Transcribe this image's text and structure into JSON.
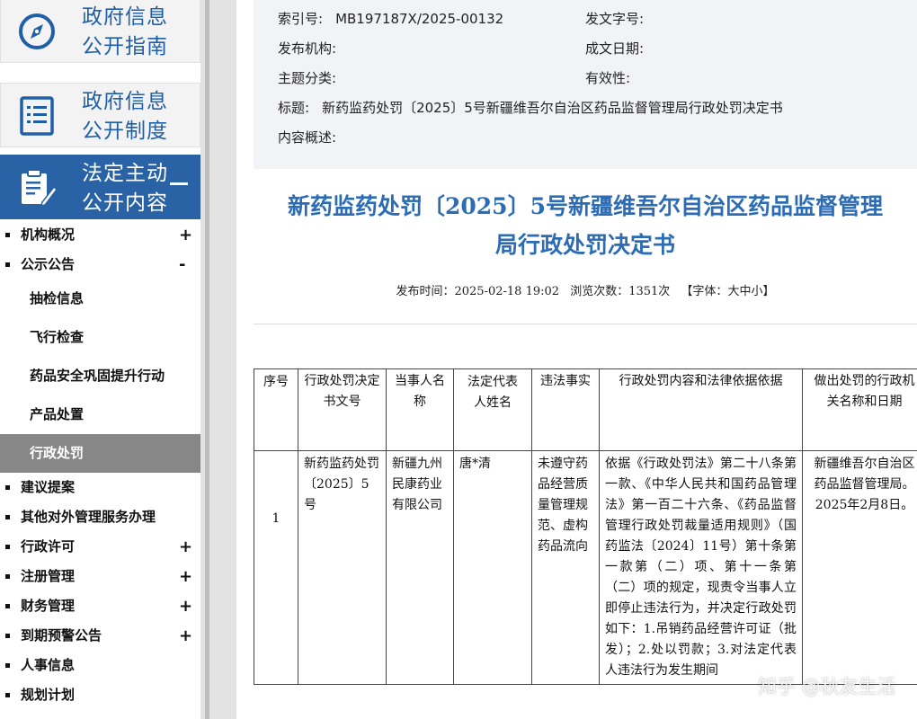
{
  "sidebar": {
    "top_buttons": [
      {
        "line1": "政府信息",
        "line2": "公开指南",
        "icon": "compass-icon"
      },
      {
        "line1": "政府信息",
        "line2": "公开制度",
        "icon": "list-document-icon"
      },
      {
        "line1": "法定主动",
        "line2": "公开内容",
        "icon": "document-edit-icon"
      }
    ],
    "menu_items": [
      {
        "label": "机构概况",
        "toggle": "+"
      },
      {
        "label": "公示公告",
        "toggle": "-"
      }
    ],
    "sub_items": [
      "抽检信息",
      "飞行检查",
      "药品安全巩固提升行动",
      "产品处置",
      "行政处罚"
    ],
    "active_sub": "行政处罚",
    "menu_items_after": [
      {
        "label": "建议提案",
        "toggle": ""
      },
      {
        "label": "其他对外管理服务办理",
        "toggle": ""
      },
      {
        "label": "行政许可",
        "toggle": "+"
      },
      {
        "label": "注册管理",
        "toggle": "+"
      },
      {
        "label": "财务管理",
        "toggle": "+"
      },
      {
        "label": "到期预警公告",
        "toggle": "+"
      },
      {
        "label": "人事信息",
        "toggle": ""
      },
      {
        "label": "规划计划",
        "toggle": ""
      }
    ]
  },
  "meta": {
    "index_label": "索引号:",
    "index_value": "MB197187X/2025-00132",
    "doc_no_label": "发文字号:",
    "doc_no_value": "",
    "publisher_label": "发布机构:",
    "publisher_value": "",
    "date_label": "成文日期:",
    "date_value": "",
    "topic_label": "主题分类:",
    "topic_value": "",
    "validity_label": "有效性:",
    "validity_value": "",
    "title_label": "标题:",
    "title_value": "新药监药处罚〔2025〕5号新疆维吾尔自治区药品监督管理局行政处罚决定书",
    "summary_label": "内容概述:",
    "summary_value": ""
  },
  "article": {
    "title_line1": "新药监药处罚〔2025〕5号新疆维吾尔自治区药品监督管理",
    "title_line2": "局行政处罚决定书",
    "publish_time": "发布时间：2025-02-18 19:02",
    "views": "浏览次数：1351次",
    "font_size_open": "【字体：",
    "font_size_options": [
      "大",
      "中",
      "小"
    ],
    "font_size_close": "】"
  },
  "table": {
    "headers": [
      "序号",
      "行政处罚决定书文号",
      "当事人名称",
      "法定代表人姓名",
      "违法事实",
      "行政处罚内容和法律依据依据",
      "做出处罚的行政机关名称和日期"
    ],
    "rows": [
      {
        "no": "1",
        "doc_no": "新药监药处罚〔2025〕5号",
        "party": "新疆九州民康药业有限公司",
        "legal_rep": "唐*清",
        "facts": "未遵守药品经营质量管理规范、虚构药品流向",
        "content": "依据《行政处罚法》第二十八条第一款、《中华人民共和国药品管理法》第一百二十六条、《药品监督管理行政处罚裁量适用规则》（国药监法〔2024〕11号）第十条第一款第（二）项、第十一条第（二）项的规定，现责令当事人立即停止违法行为，并决定行政处罚如下：1.吊销药品经营许可证（批发）；2.处以罚款；3.对法定代表人违法行为发生期间",
        "authority": "新疆维吾尔自治区药品监督管理局。2025年2月8日。"
      }
    ]
  },
  "watermark": "知乎 @秋友生活",
  "colors": {
    "accent": "#2a63a5",
    "title": "#2c6cb5",
    "active_sub": "#878787"
  }
}
